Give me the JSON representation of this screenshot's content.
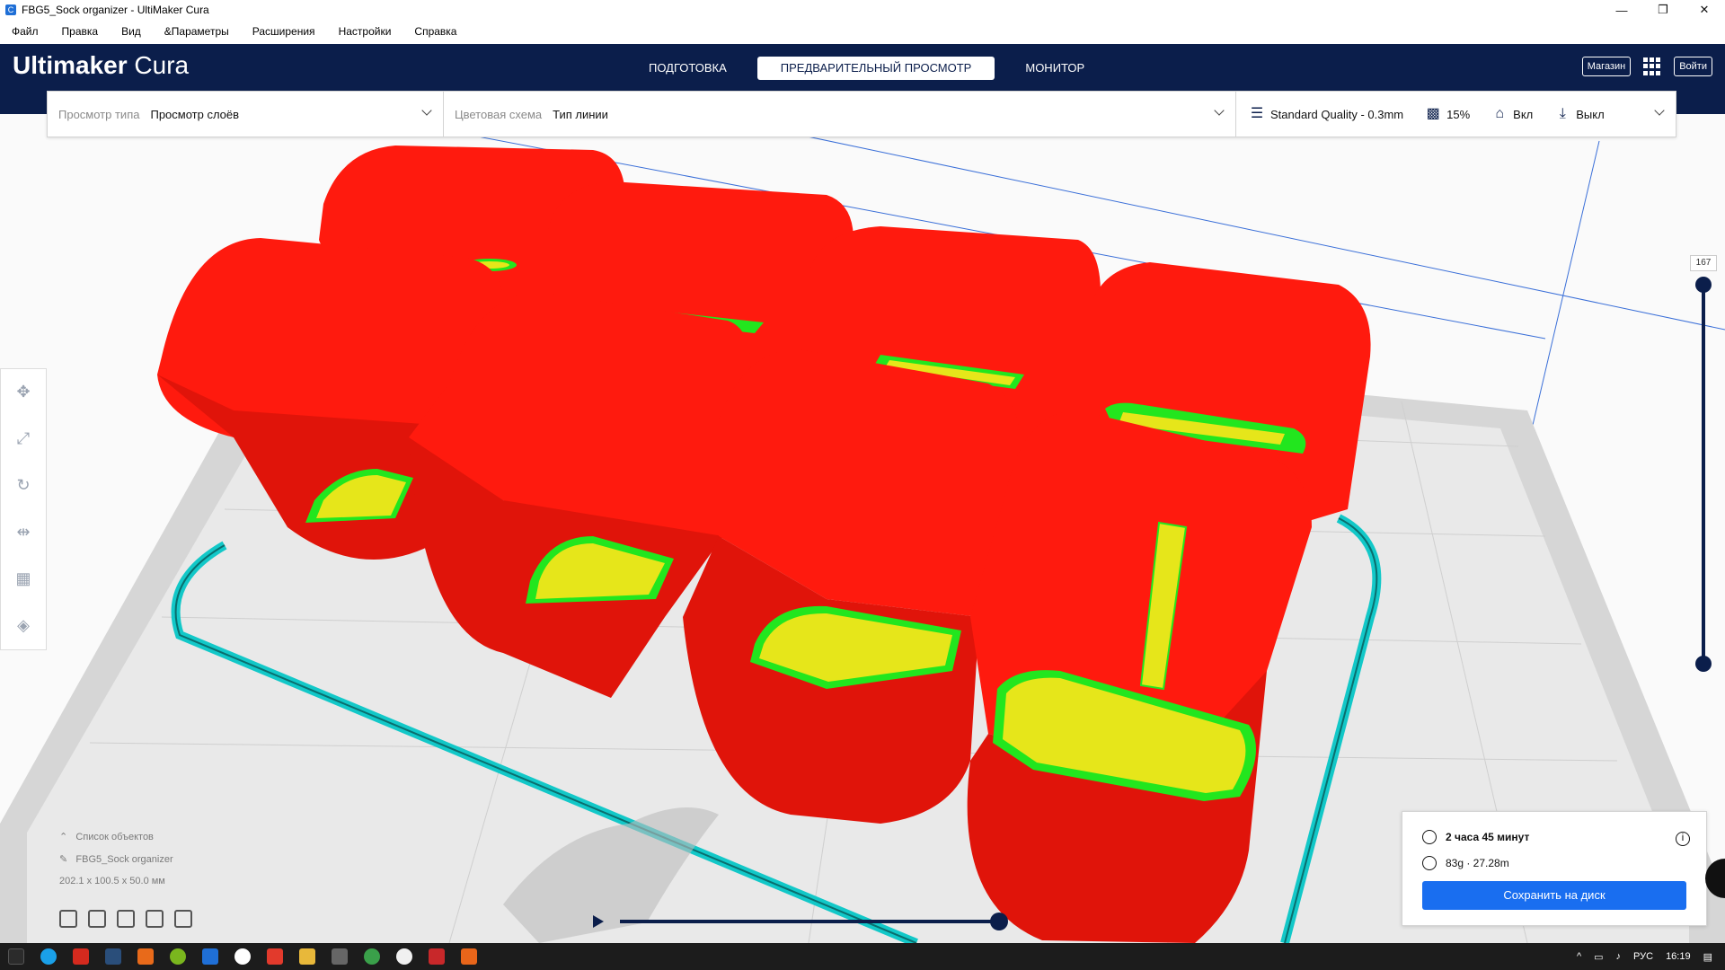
{
  "window": {
    "title": "FBG5_Sock organizer - UltiMaker Cura",
    "minimize_icon": "minimize-icon",
    "restore_icon": "restore-icon",
    "close_icon": "close-icon"
  },
  "menu": [
    "Файл",
    "Правка",
    "Вид",
    "&Параметры",
    "Расширения",
    "Настройки",
    "Справка"
  ],
  "header": {
    "brand_bold": "Ultimaker",
    "brand_light": "Cura",
    "tabs": [
      {
        "label": "ПОДГОТОВКА",
        "active": false
      },
      {
        "label": "ПРЕДВАРИТЕЛЬНЫЙ ПРОСМОТР",
        "active": true
      },
      {
        "label": "МОНИТОР",
        "active": false
      }
    ],
    "marketplace_label": "Магазин",
    "signin_label": "Войти"
  },
  "toolbar": {
    "view_type_label": "Просмотр типа",
    "view_type_value": "Просмотр слоёв",
    "color_scheme_label": "Цветовая схема",
    "color_scheme_value": "Тип линии",
    "profile": "Standard Quality - 0.3mm",
    "infill": "15%",
    "support": "Вкл",
    "adhesion": "Выкл"
  },
  "layer_slider": {
    "max_layer": "167"
  },
  "object_list": {
    "title": "Список объектов",
    "object_name": "FBG5_Sock organizer",
    "dimensions": "202.1 x 100.5 x 50.0 мм"
  },
  "print_info": {
    "time": "2 часа 45 минут",
    "material": "83g · 27.28m",
    "save_label": "Сохранить на диск"
  },
  "taskbar": {
    "language": "РУС",
    "clock": "16:19"
  },
  "colors": {
    "header_bg": "#0b1e4b",
    "wall_red": "#ff1a0e",
    "infill_yellow": "#e6e61a",
    "skin_green": "#22e61e",
    "skirt_cyan": "#12c8c8",
    "save_blue": "#196ef0"
  }
}
